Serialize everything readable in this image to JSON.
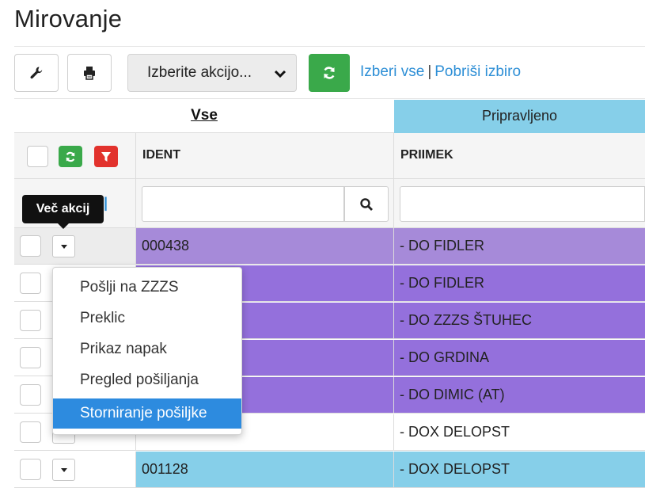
{
  "page": {
    "title": "Mirovanje"
  },
  "toolbar": {
    "settings_icon": "wrench-icon",
    "print_icon": "printer-icon",
    "action_select": {
      "value": "Izberite akcijo..."
    },
    "refresh_icon": "refresh-icon",
    "select_all": "Izberi vse",
    "separator": "|",
    "clear_selection": "Pobriši izbiro"
  },
  "grid": {
    "groups": [
      {
        "label": "Vse"
      },
      {
        "label": "Pripravljeno",
        "color": "#86cfe9"
      }
    ],
    "columns": [
      {
        "key": "ident",
        "header": "IDENT"
      },
      {
        "key": "priimek",
        "header": "PRIIMEK"
      }
    ],
    "filter": {
      "search_icon": "search-icon"
    },
    "rows": [
      {
        "ident": "000438",
        "priimek": "- DO FIDLER",
        "color": "#a68ad9"
      },
      {
        "ident": "",
        "priimek": "- DO FIDLER",
        "color": "#9470dc"
      },
      {
        "ident": "",
        "priimek": "- DO ZZZS ŠTUHEC",
        "color": "#9470dc"
      },
      {
        "ident": "",
        "priimek": "- DO GRDINA",
        "color": "#9470dc"
      },
      {
        "ident": "",
        "priimek": "- DO DIMIC (AT)",
        "color": "#9470dc"
      },
      {
        "ident": "",
        "priimek": "- DOX DELOPST",
        "color": "#ffffff"
      },
      {
        "ident": "001128",
        "priimek": "- DOX DELOPST",
        "color": "#86cfe9"
      }
    ]
  },
  "tooltip": {
    "text": "Več akcij"
  },
  "context_menu": {
    "items": [
      {
        "label": "Pošlji na ZZZS"
      },
      {
        "label": "Preklic"
      },
      {
        "label": "Prikaz napak"
      },
      {
        "label": "Pregled pošiljanja"
      },
      {
        "label": "Storniranje pošiljke",
        "active": true
      }
    ],
    "highlight_color": "#2d8bdf"
  }
}
